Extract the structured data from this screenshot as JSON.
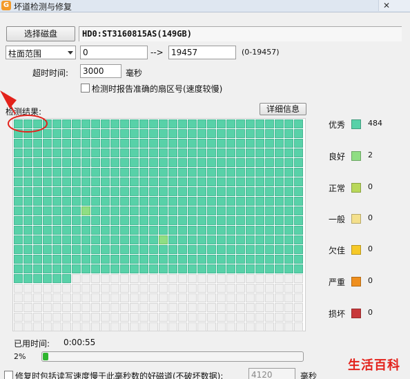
{
  "window": {
    "title": "坏道检测与修复",
    "close_glyph": "✕"
  },
  "disk": {
    "select_button": "选择磁盘",
    "info": "HD0:ST3160815AS(149GB)"
  },
  "range": {
    "mode": "柱面范围",
    "start": "0",
    "arrow": "-->",
    "end": "19457",
    "hint": "(0-19457)"
  },
  "timeout": {
    "label": "超时时间:",
    "value": "3000",
    "unit": "毫秒"
  },
  "accurate": {
    "label": "检测时报告准确的扇区号(速度较慢)",
    "checked": false
  },
  "results": {
    "label": "检测结果:",
    "details_button": "详细信息"
  },
  "grid": {
    "columns": 30,
    "rows": 22,
    "scanned_cells": 486,
    "good_cell_indices": [
      277,
      375
    ],
    "colors": {
      "excellent": "#58d1a8",
      "good": "#8fde83",
      "unscanned": "#efefef"
    }
  },
  "legend": [
    {
      "label": "优秀",
      "count": "484",
      "color": "#58d1a8"
    },
    {
      "label": "良好",
      "count": "2",
      "color": "#8fde83"
    },
    {
      "label": "正常",
      "count": "0",
      "color": "#b9d85a"
    },
    {
      "label": "一般",
      "count": "0",
      "color": "#f4e08c"
    },
    {
      "label": "欠佳",
      "count": "0",
      "color": "#f6c928"
    },
    {
      "label": "严重",
      "count": "0",
      "color": "#ef8f1e"
    },
    {
      "label": "损坏",
      "count": "0",
      "color": "#c8393b"
    }
  ],
  "status": {
    "elapsed_label": "已用时间:",
    "elapsed_value": "0:00:55",
    "percent_text": "2%",
    "progress_fraction": 0.02
  },
  "repair": {
    "label": "修复时包括读写速度慢于此毫秒数的好磁道(不破坏数据):",
    "value": "4120",
    "unit": "毫秒",
    "checked": false
  },
  "watermark": "生活百科",
  "annotation_color": "#e3221b"
}
